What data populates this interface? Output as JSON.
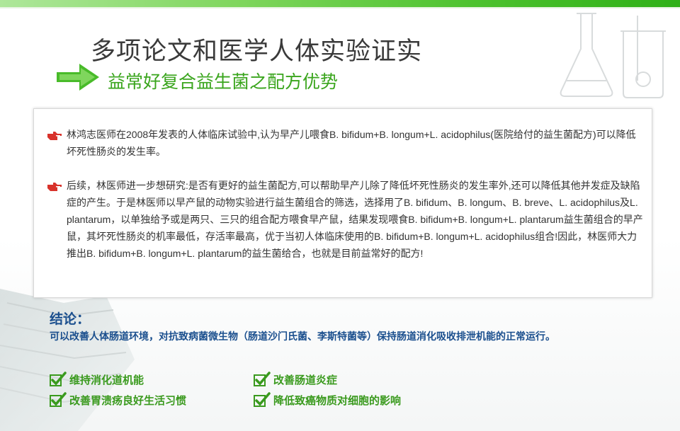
{
  "header": {
    "main_title": "多项论文和医学人体实验证实",
    "sub_title": "益常好复合益生菌之配方优势"
  },
  "content": {
    "paragraphs": [
      "林鸿志医师在2008年发表的人体临床试验中,认为早产儿喂食B. bifidum+B. longum+L. acidophilus(医院给付的益生菌配方)可以降低坏死性肠炎的发生率。",
      "后续，林医师进一步想研究:是否有更好的益生菌配方,可以帮助早产儿除了降低坏死性肠炎的发生率外,还可以降低其他并发症及缺陷症的产生。于是林医师以早产鼠的动物实验进行益生菌组合的筛选，选择用了B. bifidum、B. longum、B. breve、L. acidophilus及L. plantarum，以单独给予或是两只、三只的组合配方喂食早产鼠，结果发现喂食B. bifidum+B. longum+L. plantarum益生菌组合的早产鼠，其坏死性肠炎的机率最低，存活率最高，优于当初人体临床使用的B. bifidum+B. longum+L. acidophilus组合!因此，林医师大力推出B. bifidum+B. longum+L. plantarum的益生菌给合，也就是目前益常好的配方!"
    ],
    "bullet_icon": "pointing-hand-icon"
  },
  "conclusion": {
    "heading": "结论：",
    "text": "可以改善人体肠道环境，对抗致病菌微生物（肠道沙门氏菌、李斯特菌等）保持肠道消化吸收排泄机能的正常运行。",
    "benefits": [
      "维持消化道机能",
      "改善肠道炎症",
      "改善胃溃疡良好生活习惯",
      "降低致癌物质对细胞的影响"
    ],
    "check_icon": "green-checkmark-icon"
  },
  "colors": {
    "accent_green": "#3aa51d",
    "conclusion_blue": "#1b4f8e",
    "bullet_red": "#d8322b"
  }
}
